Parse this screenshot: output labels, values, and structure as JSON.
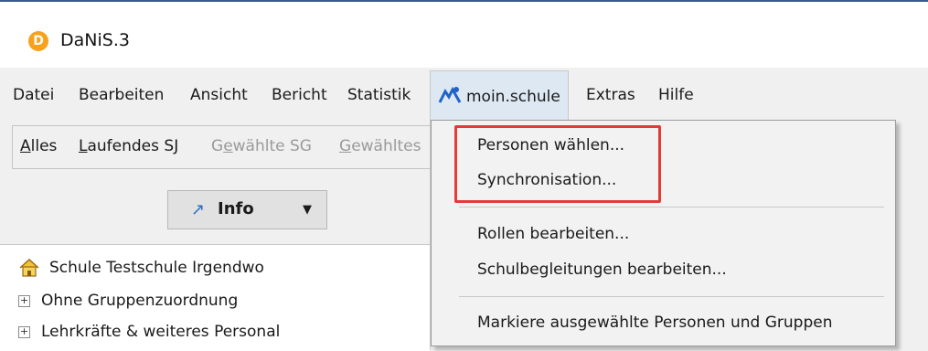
{
  "window": {
    "title": "DaNiS.3",
    "app_icon_glyph": "D"
  },
  "menubar": {
    "items": [
      "Datei",
      "Bearbeiten",
      "Ansicht",
      "Bericht",
      "Statistik",
      "moin.schule",
      "Extras",
      "Hilfe"
    ]
  },
  "filters": {
    "items": [
      {
        "pre": "",
        "u": "A",
        "post": "lles"
      },
      {
        "pre": "",
        "u": "L",
        "post": "aufendes SJ"
      },
      {
        "pre": "G",
        "u": "e",
        "post": "wählte SG"
      },
      {
        "pre": "",
        "u": "G",
        "post": "ewähltes"
      }
    ]
  },
  "info_button": {
    "label": "Info",
    "arrow_icon": "↗",
    "caret": "▼"
  },
  "tree": {
    "items": [
      {
        "label": "Schule Testschule Irgendwo",
        "icon": "school-icon"
      },
      {
        "label": "Ohne Gruppenzuordnung",
        "expander": "+"
      },
      {
        "label": "Lehrkräfte & weiteres Personal",
        "expander": "+"
      }
    ]
  },
  "dropdown": {
    "items": [
      "Personen wählen...",
      "Synchronisation...",
      "Rollen bearbeiten...",
      "Schulbegleitungen bearbeiten...",
      "Markiere ausgewählte Personen und Gruppen"
    ]
  },
  "colors": {
    "highlight_border": "#e53a3a",
    "open_menu_bg": "#dde8f3",
    "accent_blue": "#2d6fc7",
    "logo_orange": "#f6a21c"
  }
}
